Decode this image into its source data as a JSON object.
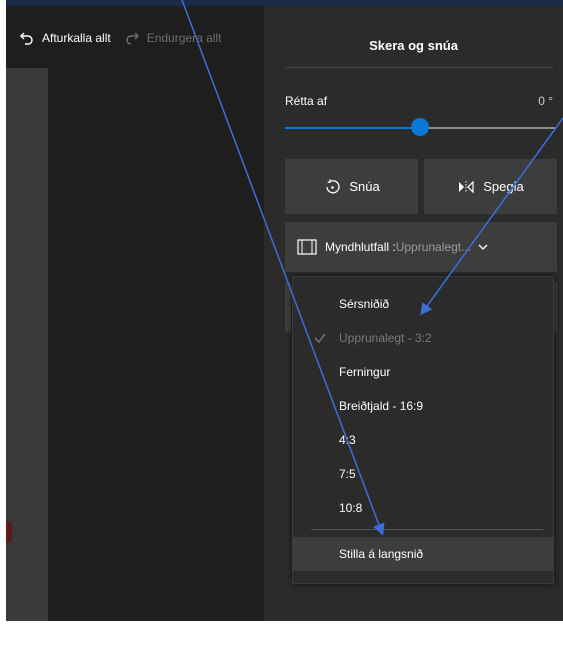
{
  "toolbar": {
    "undo_all": "Afturkalla allt",
    "redo_all": "Endurgera allt"
  },
  "panel": {
    "title": "Skera og snúa",
    "straighten": {
      "label": "Rétta af",
      "value": "0 °",
      "level": 0.5
    },
    "rotate_label": "Snúa",
    "flip_label": "Spegla",
    "aspect": {
      "label": "Myndhlutfall : ",
      "value": "Upprunalegt... "
    }
  },
  "dropdown": {
    "items": [
      {
        "label": "Sérsniðið",
        "state": "normal"
      },
      {
        "label": "Upprunalegt - 3:2",
        "state": "selected-disabled"
      },
      {
        "label": "Ferningur",
        "state": "normal"
      },
      {
        "label": "Breiðtjald - 16:9",
        "state": "normal"
      },
      {
        "label": "4:3",
        "state": "normal"
      },
      {
        "label": "7:5",
        "state": "normal"
      },
      {
        "label": "10:8",
        "state": "normal"
      },
      {
        "label": "Stilla á langsnið",
        "state": "hover"
      }
    ]
  },
  "icons": [
    "undo-icon",
    "redo-icon",
    "rotate-icon",
    "flip-icon",
    "aspect-ratio-icon",
    "chevron-down-icon",
    "checkmark-icon"
  ],
  "colors": {
    "accent": "#0a78d7",
    "annotation_arrow": "#3a6fd8",
    "panel_bg": "#2b2b2b"
  }
}
